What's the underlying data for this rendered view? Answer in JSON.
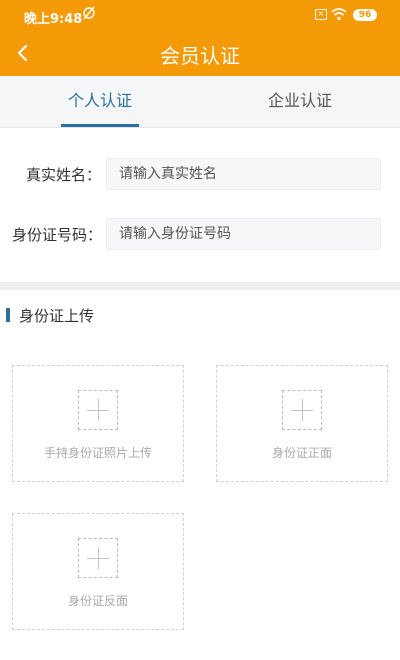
{
  "status_bar": {
    "time": "晚上9:48",
    "battery": "96",
    "sim_label": "×"
  },
  "header": {
    "title": "会员认证"
  },
  "tabs": [
    {
      "label": "个人认证",
      "active": true
    },
    {
      "label": "企业认证",
      "active": false
    }
  ],
  "form": {
    "name": {
      "label": "真实姓名：",
      "placeholder": "请输入真实姓名",
      "value": ""
    },
    "id_number": {
      "label": "身份证号码：",
      "placeholder": "请输入身份证号码",
      "value": ""
    }
  },
  "upload_section": {
    "title": "身份证上传",
    "boxes": [
      {
        "label": "手持身份证照片上传"
      },
      {
        "label": "身份证正面"
      },
      {
        "label": "身份证反面"
      }
    ]
  },
  "colors": {
    "accent": "#f39a06",
    "primary": "#2a6f9e"
  },
  "icons": {
    "back": "chevron-left-icon",
    "alarm": "alarm-off-icon",
    "wifi": "wifi-icon",
    "battery": "battery-icon",
    "plus": "plus-icon"
  }
}
